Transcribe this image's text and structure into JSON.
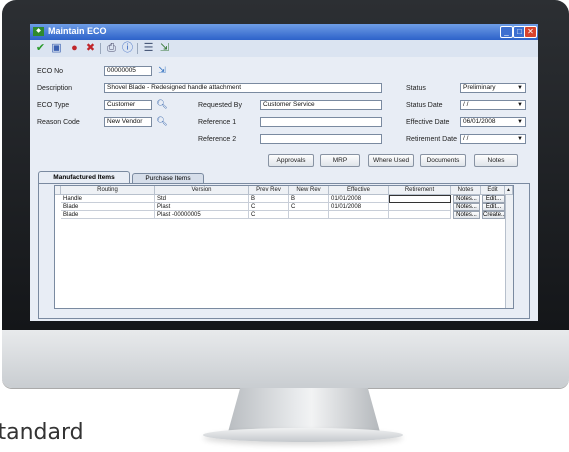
{
  "caption": "standard",
  "window": {
    "title": "Maintain ECO"
  },
  "toolbar": [
    "check-icon",
    "save-icon",
    "cancel-icon",
    "delete-icon",
    "print-icon",
    "help-icon",
    "list-icon",
    "export-icon"
  ],
  "form": {
    "eco_no": {
      "label": "ECO No",
      "value": "00000005"
    },
    "description": {
      "label": "Description",
      "value": "Shovel Blade - Redesigned handle attachment"
    },
    "eco_type": {
      "label": "ECO Type",
      "value": "Customer"
    },
    "reason_code": {
      "label": "Reason Code",
      "value": "New Vendor"
    },
    "requested_by": {
      "label": "Requested By",
      "value": "Customer Service"
    },
    "reference1": {
      "label": "Reference 1",
      "value": ""
    },
    "reference2": {
      "label": "Reference 2",
      "value": ""
    },
    "status": {
      "label": "Status",
      "value": "Preliminary"
    },
    "status_date": {
      "label": "Status Date",
      "value": " / /"
    },
    "effective_date": {
      "label": "Effective Date",
      "value": "06/01/2008"
    },
    "retirement_date": {
      "label": "Retirement Date",
      "value": " / /"
    }
  },
  "buttons": {
    "approvals": "Approvals",
    "mrp": "MRP",
    "where_used": "Where Used",
    "documents": "Documents",
    "notes": "Notes"
  },
  "tabs": {
    "manufactured": "Manufactured Items",
    "purchase": "Purchase Items"
  },
  "grid": {
    "headers": [
      "Routing",
      "Version",
      "Prev Rev",
      "New Rev",
      "Effective",
      "Retirement",
      "Notes",
      "Edit"
    ],
    "rows": [
      {
        "routing": "Handle",
        "version": "Std",
        "prev": "B",
        "new": "B",
        "effective": "01/01/2008",
        "retirement": "",
        "notes": "Notes...",
        "edit": "Edit..."
      },
      {
        "routing": "Blade",
        "version": "Plast",
        "prev": "C",
        "new": "C",
        "effective": "01/01/2008",
        "retirement": "",
        "notes": "Notes...",
        "edit": "Edit..."
      },
      {
        "routing": "Blade",
        "version": "Plast -00000005",
        "prev": "C",
        "new": "",
        "effective": "",
        "retirement": "",
        "notes": "Notes...",
        "edit": "Create..."
      }
    ]
  }
}
